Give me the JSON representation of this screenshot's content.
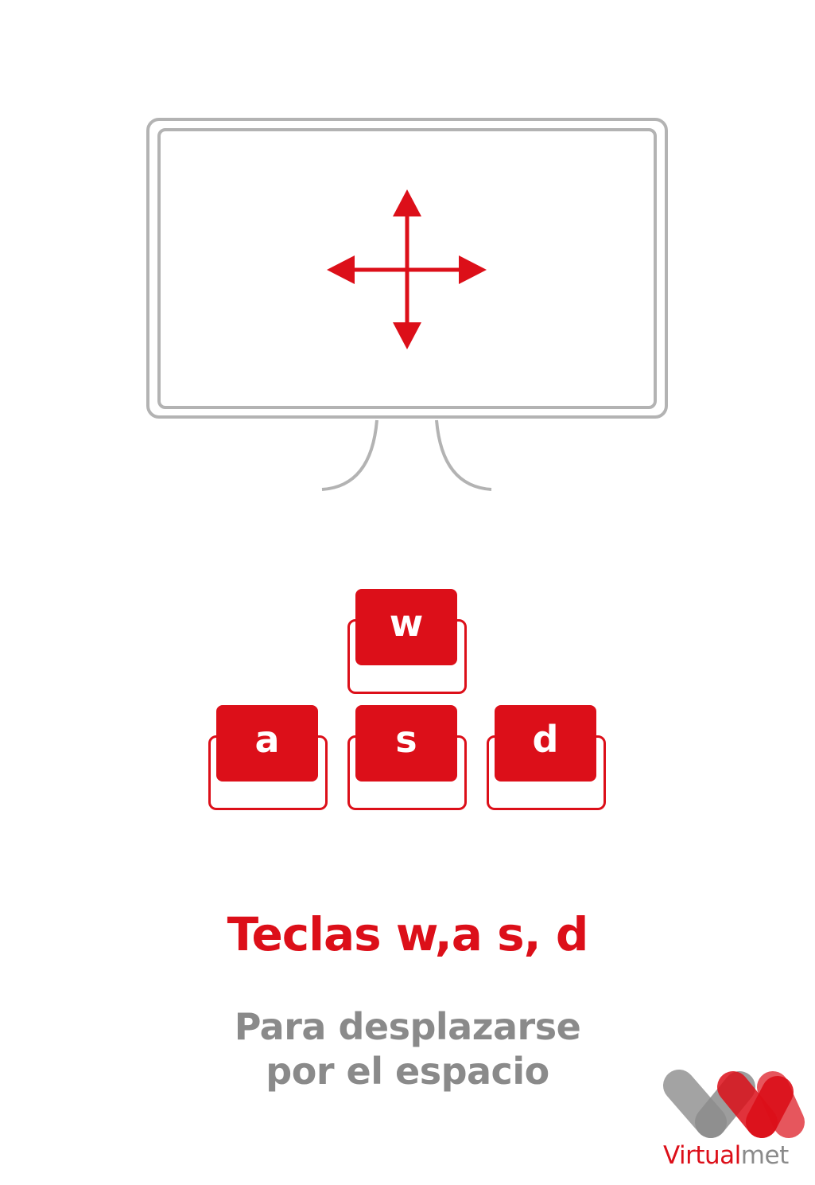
{
  "illustration": {
    "monitor_icon": "monitor-icon",
    "move_icon": "four-way-arrow-icon",
    "stroke_color": "#b3b3b3",
    "accent_color": "#dc0f19"
  },
  "keys": {
    "w": "w",
    "a": "a",
    "s": "s",
    "d": "d"
  },
  "title": "Teclas w,a s, d",
  "subtitle": {
    "line1": "Para desplazarse",
    "line2": "por el espacio"
  },
  "logo": {
    "text_part1": "Virtual",
    "text_part2": "met",
    "icon": "virtualmet-logo-icon"
  }
}
